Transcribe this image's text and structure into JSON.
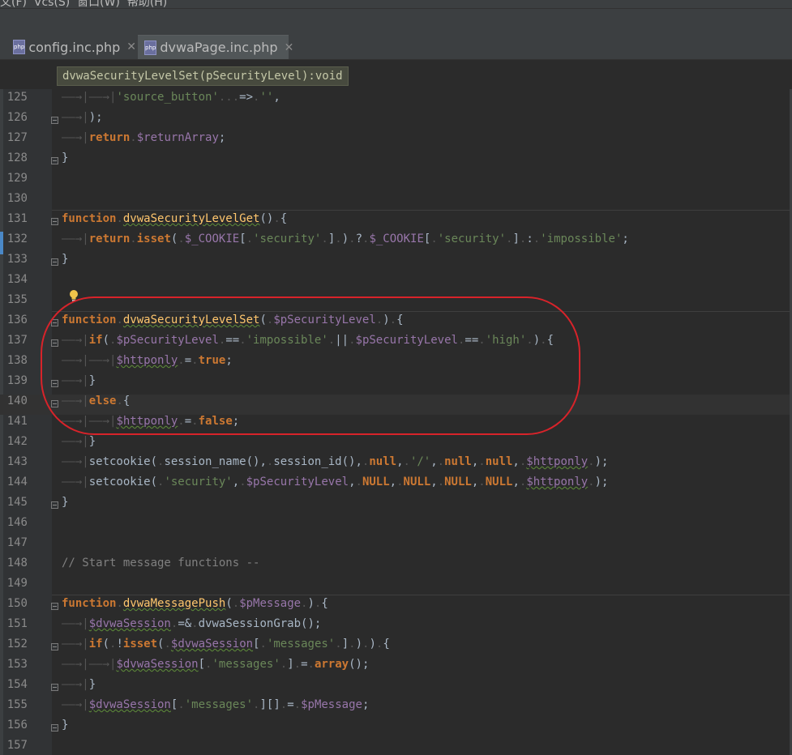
{
  "menu": {
    "text": "文(F)  Vcs(S)  窗口(W)  帮助(H)"
  },
  "tabs": [
    {
      "label": "config.inc.php",
      "icon": "php-file-icon",
      "active": false
    },
    {
      "label": "dvwaPage.inc.php",
      "icon": "php-file-icon",
      "active": true
    }
  ],
  "breadcrumb": {
    "label": "dvwaSecurityLevelSet(pSecurityLevel):void"
  },
  "colors": {
    "keyword": "#cc7832",
    "function": "#ffc66d",
    "variable": "#9876aa",
    "string": "#6a8759",
    "comment": "#808080",
    "default": "#a9b7c6",
    "annotation": "#d8232a"
  },
  "lines": [
    {
      "n": "125",
      "fold": false,
      "tokens": [
        [
          "ws",
          "——→|——→|"
        ],
        [
          "str",
          "'source_button'"
        ],
        [
          "ws",
          "..."
        ],
        [
          "d",
          "=>"
        ],
        [
          "ws",
          "."
        ],
        [
          "str",
          "''"
        ],
        [
          "d",
          ","
        ]
      ]
    },
    {
      "n": "126",
      "fold": true,
      "tokens": [
        [
          "ws",
          "——→|"
        ],
        [
          "d",
          ");"
        ]
      ]
    },
    {
      "n": "127",
      "fold": false,
      "tokens": [
        [
          "ws",
          "——→|"
        ],
        [
          "kw",
          "return"
        ],
        [
          "ws",
          "."
        ],
        [
          "var",
          "$returnArray"
        ],
        [
          "d",
          ";"
        ]
      ]
    },
    {
      "n": "128",
      "fold": true,
      "tokens": [
        [
          "d",
          "}"
        ]
      ]
    },
    {
      "n": "129",
      "fold": false,
      "tokens": []
    },
    {
      "n": "130",
      "fold": false,
      "tokens": []
    },
    {
      "n": "131",
      "fold": true,
      "tokens": [
        [
          "kw",
          "function"
        ],
        [
          "ws",
          "."
        ],
        [
          "fnw",
          "dvwaSecurityLevelGet"
        ],
        [
          "d",
          "()"
        ],
        [
          "ws",
          "."
        ],
        [
          "d",
          "{"
        ]
      ]
    },
    {
      "n": "132",
      "fold": false,
      "tokens": [
        [
          "ws",
          "——→|"
        ],
        [
          "kw",
          "return"
        ],
        [
          "ws",
          "."
        ],
        [
          "kw",
          "isset"
        ],
        [
          "d",
          "("
        ],
        [
          "ws",
          "."
        ],
        [
          "var",
          "$_COOKIE"
        ],
        [
          "d",
          "["
        ],
        [
          "ws",
          "."
        ],
        [
          "str",
          "'security'"
        ],
        [
          "ws",
          "."
        ],
        [
          "d",
          "]"
        ],
        [
          "ws",
          "."
        ],
        [
          "d",
          ")"
        ],
        [
          "ws",
          "."
        ],
        [
          "d",
          "?"
        ],
        [
          "ws",
          "."
        ],
        [
          "var",
          "$_COOKIE"
        ],
        [
          "d",
          "["
        ],
        [
          "ws",
          "."
        ],
        [
          "str",
          "'security'"
        ],
        [
          "ws",
          "."
        ],
        [
          "d",
          "]"
        ],
        [
          "ws",
          "."
        ],
        [
          "d",
          ":"
        ],
        [
          "ws",
          "."
        ],
        [
          "str",
          "'impossible'"
        ],
        [
          "d",
          ";"
        ]
      ]
    },
    {
      "n": "133",
      "fold": true,
      "tokens": [
        [
          "d",
          "}"
        ]
      ]
    },
    {
      "n": "134",
      "fold": false,
      "tokens": []
    },
    {
      "n": "135",
      "fold": false,
      "tokens": []
    },
    {
      "n": "136",
      "fold": true,
      "tokens": [
        [
          "kw",
          "function"
        ],
        [
          "ws",
          "."
        ],
        [
          "fnw",
          "dvwaSecurityLevelSet"
        ],
        [
          "d",
          "("
        ],
        [
          "ws",
          "."
        ],
        [
          "var",
          "$pSecurityLevel"
        ],
        [
          "ws",
          "."
        ],
        [
          "d",
          ")"
        ],
        [
          "ws",
          "."
        ],
        [
          "d",
          "{"
        ]
      ]
    },
    {
      "n": "137",
      "fold": true,
      "tokens": [
        [
          "ws",
          "——→|"
        ],
        [
          "kw",
          "if"
        ],
        [
          "d",
          "("
        ],
        [
          "ws",
          "."
        ],
        [
          "var",
          "$pSecurityLevel"
        ],
        [
          "ws",
          "."
        ],
        [
          "d",
          "=="
        ],
        [
          "ws",
          "."
        ],
        [
          "str",
          "'impossible'"
        ],
        [
          "ws",
          "."
        ],
        [
          "d",
          "||"
        ],
        [
          "ws",
          "."
        ],
        [
          "var",
          "$pSecurityLevel"
        ],
        [
          "ws",
          "."
        ],
        [
          "d",
          "=="
        ],
        [
          "ws",
          "."
        ],
        [
          "str",
          "'high'"
        ],
        [
          "ws",
          "."
        ],
        [
          "d",
          ")"
        ],
        [
          "ws",
          "."
        ],
        [
          "d",
          "{"
        ]
      ]
    },
    {
      "n": "138",
      "fold": false,
      "tokens": [
        [
          "ws",
          "——→|——→|"
        ],
        [
          "varw",
          "$httponly"
        ],
        [
          "ws",
          "."
        ],
        [
          "d",
          "="
        ],
        [
          "ws",
          "."
        ],
        [
          "kw",
          "true"
        ],
        [
          "d",
          ";"
        ]
      ]
    },
    {
      "n": "139",
      "fold": true,
      "tokens": [
        [
          "ws",
          "——→|"
        ],
        [
          "d",
          "}"
        ]
      ]
    },
    {
      "n": "140",
      "fold": true,
      "current": true,
      "tokens": [
        [
          "ws",
          "——→|"
        ],
        [
          "kw",
          "else"
        ],
        [
          "ws",
          "."
        ],
        [
          "d",
          "{"
        ]
      ]
    },
    {
      "n": "141",
      "fold": false,
      "tokens": [
        [
          "ws",
          "——→|——→|"
        ],
        [
          "varw",
          "$httponly"
        ],
        [
          "ws",
          "."
        ],
        [
          "d",
          "="
        ],
        [
          "ws",
          "."
        ],
        [
          "kw",
          "false"
        ],
        [
          "d",
          ";"
        ]
      ]
    },
    {
      "n": "142",
      "fold": false,
      "tokens": [
        [
          "ws",
          "——→|"
        ],
        [
          "d",
          "}"
        ]
      ]
    },
    {
      "n": "143",
      "fold": false,
      "tokens": [
        [
          "ws",
          "——→|"
        ],
        [
          "d",
          "setcookie("
        ],
        [
          "ws",
          "."
        ],
        [
          "d",
          "session_name(),"
        ],
        [
          "ws",
          "."
        ],
        [
          "d",
          "session_id(),"
        ],
        [
          "ws",
          "."
        ],
        [
          "kw",
          "null"
        ],
        [
          "d",
          ","
        ],
        [
          "ws",
          "."
        ],
        [
          "str",
          "'/'"
        ],
        [
          "d",
          ","
        ],
        [
          "ws",
          "."
        ],
        [
          "kw",
          "null"
        ],
        [
          "d",
          ","
        ],
        [
          "ws",
          "."
        ],
        [
          "kw",
          "null"
        ],
        [
          "d",
          ","
        ],
        [
          "ws",
          "."
        ],
        [
          "varw",
          "$httponly"
        ],
        [
          "ws",
          "."
        ],
        [
          "d",
          ");"
        ]
      ]
    },
    {
      "n": "144",
      "fold": false,
      "tokens": [
        [
          "ws",
          "——→|"
        ],
        [
          "d",
          "setcookie("
        ],
        [
          "ws",
          "."
        ],
        [
          "str",
          "'security'"
        ],
        [
          "d",
          ","
        ],
        [
          "ws",
          "."
        ],
        [
          "var",
          "$pSecurityLevel"
        ],
        [
          "d",
          ","
        ],
        [
          "ws",
          "."
        ],
        [
          "kw",
          "NULL"
        ],
        [
          "d",
          ","
        ],
        [
          "ws",
          "."
        ],
        [
          "kw",
          "NULL"
        ],
        [
          "d",
          ","
        ],
        [
          "ws",
          "."
        ],
        [
          "kw",
          "NULL"
        ],
        [
          "d",
          ","
        ],
        [
          "ws",
          "."
        ],
        [
          "kw",
          "NULL"
        ],
        [
          "d",
          ","
        ],
        [
          "ws",
          "."
        ],
        [
          "varw",
          "$httponly"
        ],
        [
          "ws",
          "."
        ],
        [
          "d",
          ");"
        ]
      ]
    },
    {
      "n": "145",
      "fold": true,
      "tokens": [
        [
          "d",
          "}"
        ]
      ]
    },
    {
      "n": "146",
      "fold": false,
      "tokens": []
    },
    {
      "n": "147",
      "fold": false,
      "tokens": []
    },
    {
      "n": "148",
      "fold": false,
      "tokens": [
        [
          "cmt",
          "// Start message functions --"
        ]
      ]
    },
    {
      "n": "149",
      "fold": false,
      "tokens": []
    },
    {
      "n": "150",
      "fold": true,
      "tokens": [
        [
          "kw",
          "function"
        ],
        [
          "ws",
          "."
        ],
        [
          "fnw",
          "dvwaMessagePush"
        ],
        [
          "d",
          "("
        ],
        [
          "ws",
          "."
        ],
        [
          "var",
          "$pMessage"
        ],
        [
          "ws",
          "."
        ],
        [
          "d",
          ")"
        ],
        [
          "ws",
          "."
        ],
        [
          "d",
          "{"
        ]
      ]
    },
    {
      "n": "151",
      "fold": false,
      "tokens": [
        [
          "ws",
          "——→|"
        ],
        [
          "varw",
          "$dvwaSession"
        ],
        [
          "ws",
          "."
        ],
        [
          "d",
          "=&"
        ],
        [
          "ws",
          "."
        ],
        [
          "d",
          "dvwaSessionGrab();"
        ]
      ]
    },
    {
      "n": "152",
      "fold": true,
      "tokens": [
        [
          "ws",
          "——→|"
        ],
        [
          "kw",
          "if"
        ],
        [
          "d",
          "("
        ],
        [
          "ws",
          "."
        ],
        [
          "d",
          "!"
        ],
        [
          "kw",
          "isset"
        ],
        [
          "d",
          "("
        ],
        [
          "ws",
          "."
        ],
        [
          "varw",
          "$dvwaSession"
        ],
        [
          "d",
          "["
        ],
        [
          "ws",
          "."
        ],
        [
          "str",
          "'messages'"
        ],
        [
          "ws",
          "."
        ],
        [
          "d",
          "]"
        ],
        [
          "ws",
          "."
        ],
        [
          "d",
          ")"
        ],
        [
          "ws",
          "."
        ],
        [
          "d",
          ")"
        ],
        [
          "ws",
          "."
        ],
        [
          "d",
          "{"
        ]
      ]
    },
    {
      "n": "153",
      "fold": false,
      "tokens": [
        [
          "ws",
          "——→|——→|"
        ],
        [
          "varw",
          "$dvwaSession"
        ],
        [
          "d",
          "["
        ],
        [
          "ws",
          "."
        ],
        [
          "str",
          "'messages'"
        ],
        [
          "ws",
          "."
        ],
        [
          "d",
          "]"
        ],
        [
          "ws",
          "."
        ],
        [
          "d",
          "="
        ],
        [
          "ws",
          "."
        ],
        [
          "kw",
          "array"
        ],
        [
          "d",
          "();"
        ]
      ]
    },
    {
      "n": "154",
      "fold": true,
      "tokens": [
        [
          "ws",
          "——→|"
        ],
        [
          "d",
          "}"
        ]
      ]
    },
    {
      "n": "155",
      "fold": false,
      "tokens": [
        [
          "ws",
          "——→|"
        ],
        [
          "varw",
          "$dvwaSession"
        ],
        [
          "d",
          "["
        ],
        [
          "ws",
          "."
        ],
        [
          "str",
          "'messages'"
        ],
        [
          "ws",
          "."
        ],
        [
          "d",
          "][]"
        ],
        [
          "ws",
          "."
        ],
        [
          "d",
          "="
        ],
        [
          "ws",
          "."
        ],
        [
          "var",
          "$pMessage"
        ],
        [
          "d",
          ";"
        ]
      ]
    },
    {
      "n": "156",
      "fold": true,
      "tokens": [
        [
          "d",
          "}"
        ]
      ]
    },
    {
      "n": "157",
      "fold": false,
      "tokens": []
    }
  ]
}
